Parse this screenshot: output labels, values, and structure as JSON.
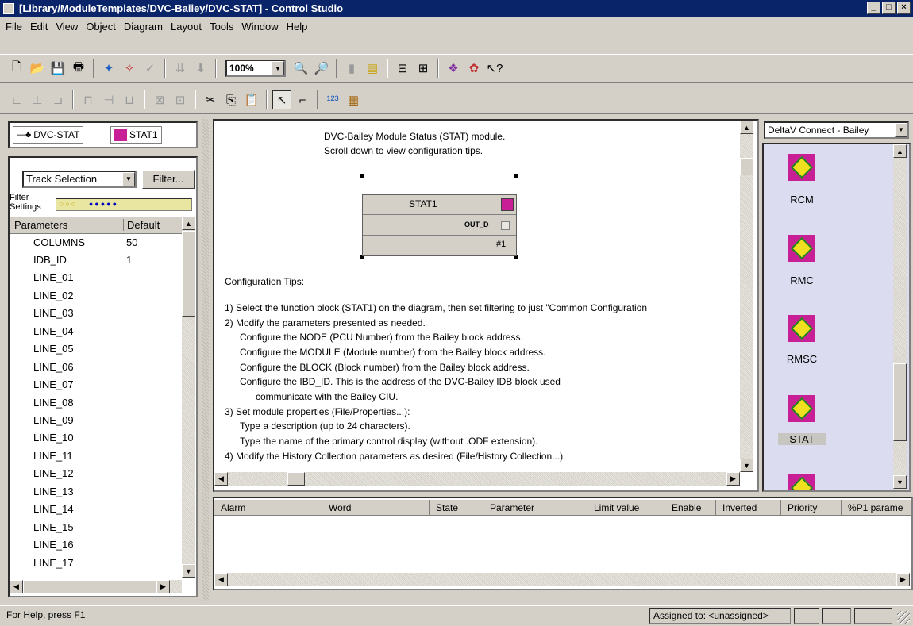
{
  "window": {
    "title": "[Library/ModuleTemplates/DVC-Bailey/DVC-STAT] - Control Studio"
  },
  "menu": [
    {
      "label": "File"
    },
    {
      "label": "Edit"
    },
    {
      "label": "View"
    },
    {
      "label": "Object"
    },
    {
      "label": "Diagram"
    },
    {
      "label": "Layout"
    },
    {
      "label": "Tools"
    },
    {
      "label": "Window"
    },
    {
      "label": "Help"
    }
  ],
  "toolbar": {
    "zoom": "100%"
  },
  "left_tabs": {
    "tab1": "DVC-STAT",
    "tab2": "STAT1"
  },
  "filter": {
    "selection": "Track Selection",
    "filter_button": "Filter...",
    "settings_label_1": "Filter",
    "settings_label_2": "Settings"
  },
  "params": {
    "headers": {
      "name": "Parameters",
      "default": "Default"
    },
    "rows": [
      {
        "name": "COLUMNS",
        "value": "50"
      },
      {
        "name": "IDB_ID",
        "value": "1"
      },
      {
        "name": "LINE_01",
        "value": ""
      },
      {
        "name": "LINE_02",
        "value": ""
      },
      {
        "name": "LINE_03",
        "value": ""
      },
      {
        "name": "LINE_04",
        "value": ""
      },
      {
        "name": "LINE_05",
        "value": ""
      },
      {
        "name": "LINE_06",
        "value": ""
      },
      {
        "name": "LINE_07",
        "value": ""
      },
      {
        "name": "LINE_08",
        "value": ""
      },
      {
        "name": "LINE_09",
        "value": ""
      },
      {
        "name": "LINE_10",
        "value": ""
      },
      {
        "name": "LINE_11",
        "value": ""
      },
      {
        "name": "LINE_12",
        "value": ""
      },
      {
        "name": "LINE_13",
        "value": ""
      },
      {
        "name": "LINE_14",
        "value": ""
      },
      {
        "name": "LINE_15",
        "value": ""
      },
      {
        "name": "LINE_16",
        "value": ""
      },
      {
        "name": "LINE_17",
        "value": ""
      }
    ]
  },
  "diagram": {
    "header_lines": [
      "DVC-Bailey Module Status (STAT) module.",
      "Scroll down to view configuration tips."
    ],
    "block": {
      "title": "STAT1",
      "output": "OUT_D",
      "index": "#1"
    },
    "tips_title": "Configuration Tips:",
    "tips": [
      "1)  Select the function block (STAT1) on the diagram, then set filtering to just \"Common Configuration",
      "2)  Modify the parameters presented as needed.",
      "Configure the NODE (PCU Number) from the Bailey block address.",
      "Configure the MODULE (Module number) from the Bailey block address.",
      "Configure the BLOCK (Block number) from the Bailey block address.",
      "Configure the IBD_ID.  This is the address of the DVC-Bailey IDB block used",
      "communicate with the Bailey CIU.",
      "3)  Set module properties (File/Properties...):",
      "Type a description (up to 24 characters).",
      "Type the name of the primary control display (without .ODF extension).",
      "4)  Modify the History Collection parameters as desired (File/History Collection...)."
    ]
  },
  "alarms": {
    "columns": [
      "Alarm",
      "Word",
      "State",
      "Parameter",
      "Limit value",
      "Enable",
      "Inverted",
      "Priority",
      "%P1 parame"
    ]
  },
  "library": {
    "selection": "DeltaV Connect - Bailey",
    "items": [
      {
        "label": "RCM",
        "icon": "function-block-icon"
      },
      {
        "label": "RMC",
        "icon": "function-block-icon"
      },
      {
        "label": "RMSC",
        "icon": "function-block-icon"
      },
      {
        "label": "STAT",
        "icon": "function-block-icon"
      }
    ]
  },
  "status": {
    "help": "For Help, press F1",
    "assigned": "Assigned to: <unassigned>"
  }
}
